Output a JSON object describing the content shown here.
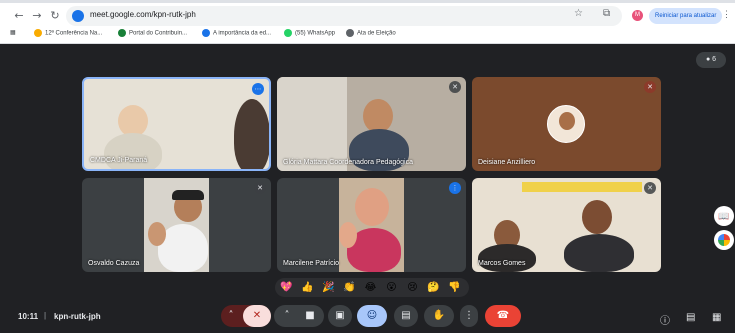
{
  "browser": {
    "url": "meet.google.com/kpn-rutk-jph",
    "restart_label": "Reiniciar para atualizar",
    "profile_initial": "M",
    "bookmarks": [
      "12ª Conferência Na...",
      "Portal do Contribuin...",
      "A importância da ed...",
      "(55) WhatsApp",
      "Ata de Eleição"
    ]
  },
  "meet": {
    "people_count": "6",
    "time": "10:11",
    "meeting_code": "kpn-rutk-jph",
    "participants": [
      {
        "name": "CMDCA Ji-Paraná"
      },
      {
        "name": "Glória Mattara Coordenadora Pedagógica"
      },
      {
        "name": "Deisiane Anzilliero"
      },
      {
        "name": "Osvaldo Cazuza"
      },
      {
        "name": "Marcilene Patrício"
      },
      {
        "name": "Marcos Gomes"
      }
    ],
    "reactions": [
      "💖",
      "👍",
      "🎉",
      "👏",
      "😂",
      "😮",
      "😢",
      "🤔",
      "👎"
    ]
  },
  "colors": {
    "meet_bg": "#202124",
    "leave": "#ea4335",
    "active_speaker": "#8ab4f8"
  }
}
